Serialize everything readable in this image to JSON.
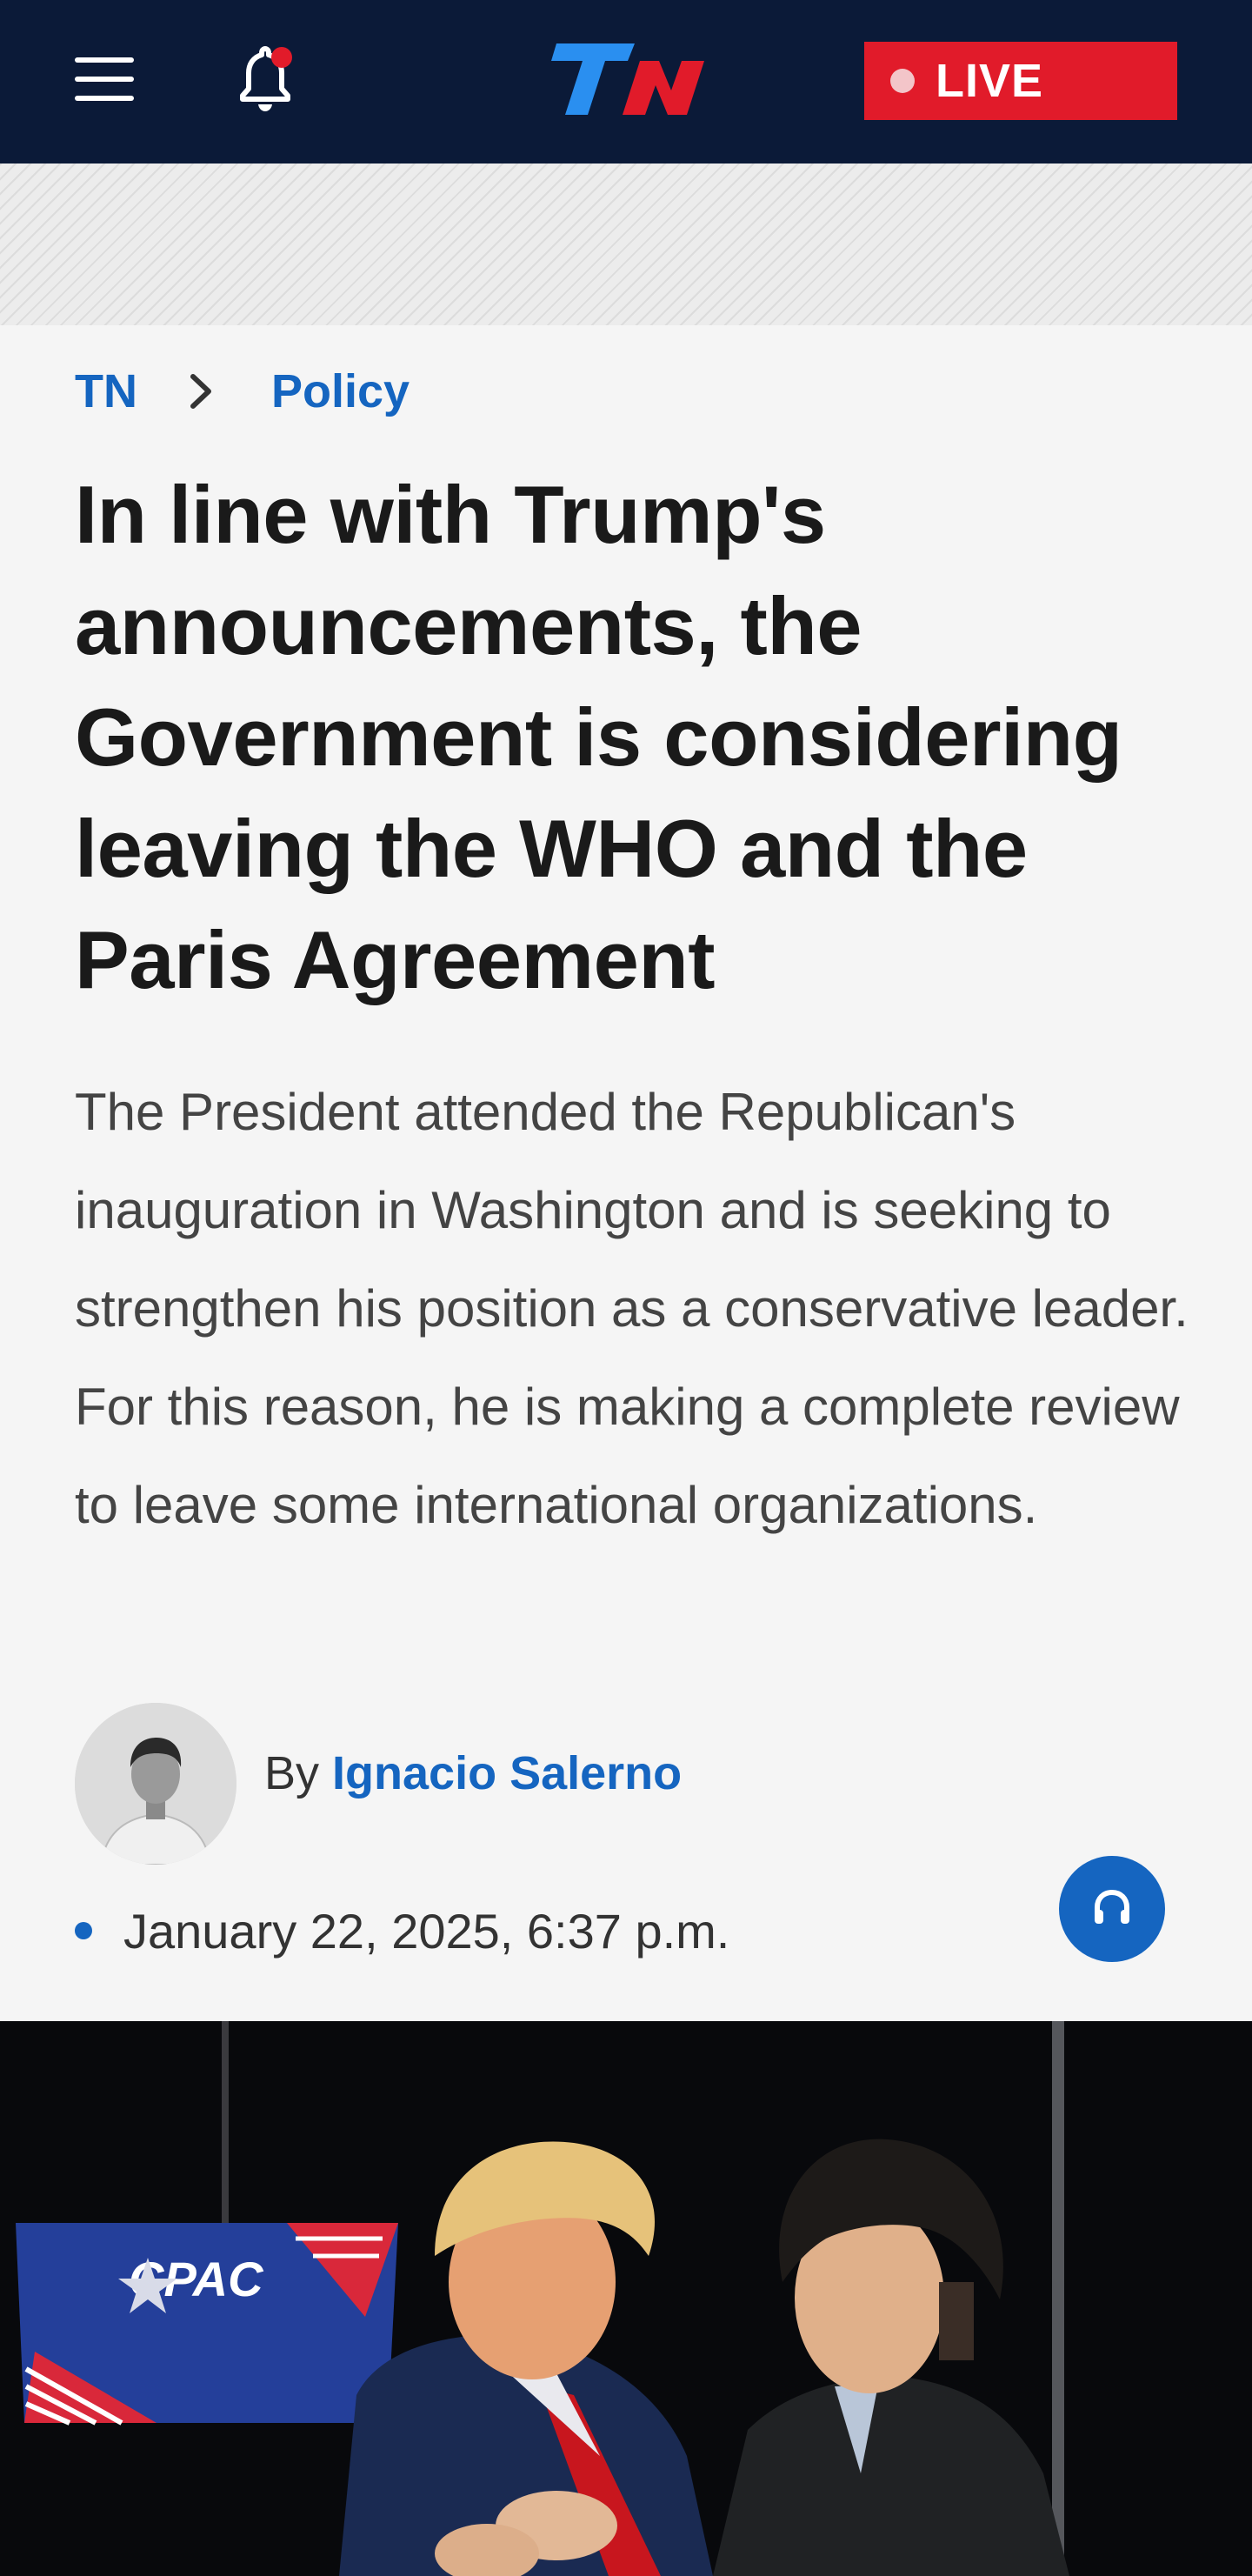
{
  "header": {
    "menu_icon": "hamburger-menu-icon",
    "notifications_icon": "bell-icon",
    "logo_text": "TN",
    "live_label": "LIVE",
    "brand_color": "#0b1a38",
    "live_color": "#e11b2a"
  },
  "breadcrumb": {
    "items": [
      {
        "label": "TN"
      },
      {
        "label": "Policy"
      }
    ],
    "separator_icon": "chevron-right-icon"
  },
  "article": {
    "headline": "In line with Trump's announcements, the Government is considering leaving the WHO and the Paris Agreement",
    "summary": "The President attended the Republican's inauguration in Washington and is seeking to strengthen his position as a conservative leader. For this reason, he is making a complete review to leave some international organizations.",
    "author": {
      "prefix": "By",
      "name": "Ignacio Salerno"
    },
    "date": "January 22, 2025, 6:37 p.m.",
    "listen_icon": "headphones-icon",
    "hero_image_logo": "CPAC"
  },
  "colors": {
    "accent": "#1565c0",
    "background": "#f5f5f5"
  }
}
